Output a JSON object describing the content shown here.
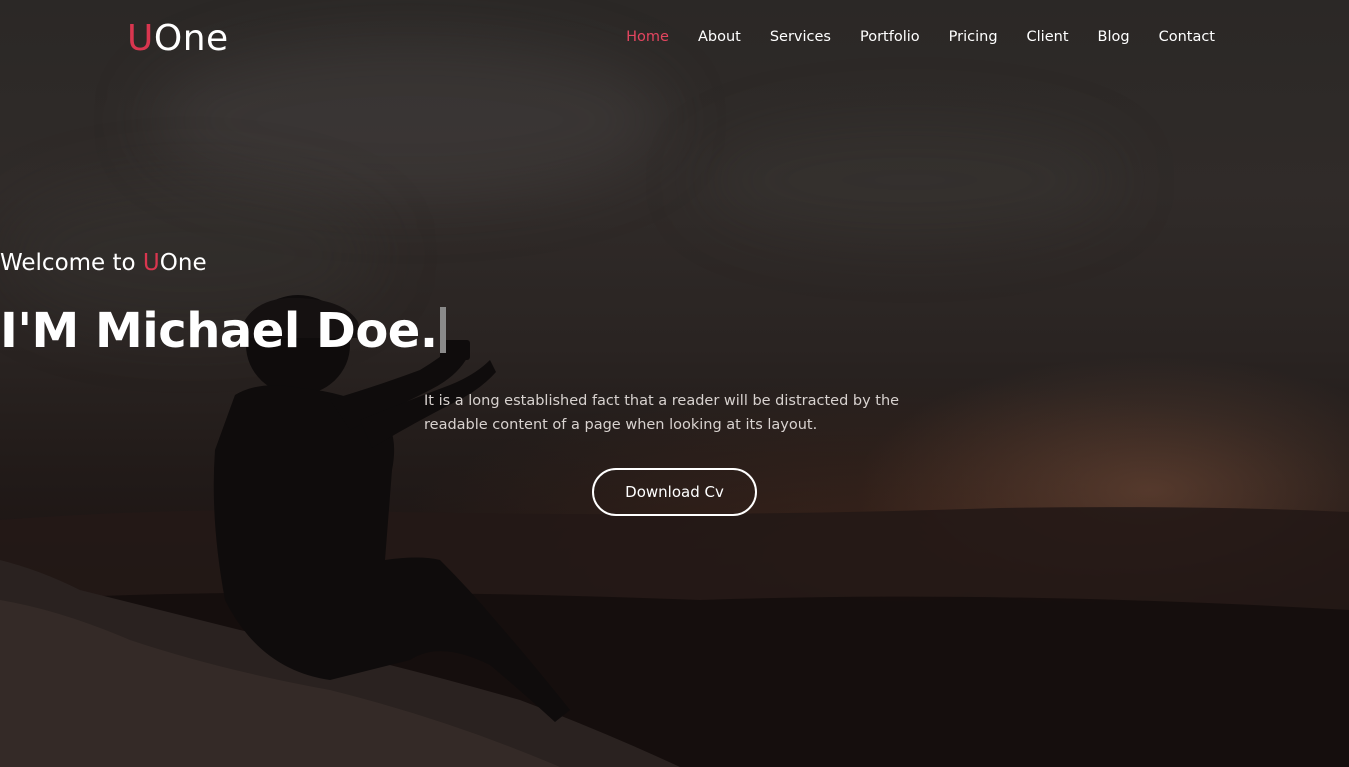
{
  "brand": {
    "logo_prefix": "U",
    "logo_rest": "One",
    "accent_color": "#d9364f"
  },
  "nav": {
    "items": [
      {
        "label": "Home",
        "active": true
      },
      {
        "label": "About",
        "active": false
      },
      {
        "label": "Services",
        "active": false
      },
      {
        "label": "Portfolio",
        "active": false
      },
      {
        "label": "Pricing",
        "active": false
      },
      {
        "label": "Client",
        "active": false
      },
      {
        "label": "Blog",
        "active": false
      },
      {
        "label": "Contact",
        "active": false
      }
    ]
  },
  "hero": {
    "welcome_text": "Welcome to ",
    "welcome_brand_prefix": "U",
    "welcome_brand_rest": "One",
    "headline": "I'M Michael Doe.",
    "description_line1": "It is a long established fact that a reader will be distracted by the",
    "description_line2": "readable content of a page when looking at its layout.",
    "cta_label": "Download Cv"
  }
}
